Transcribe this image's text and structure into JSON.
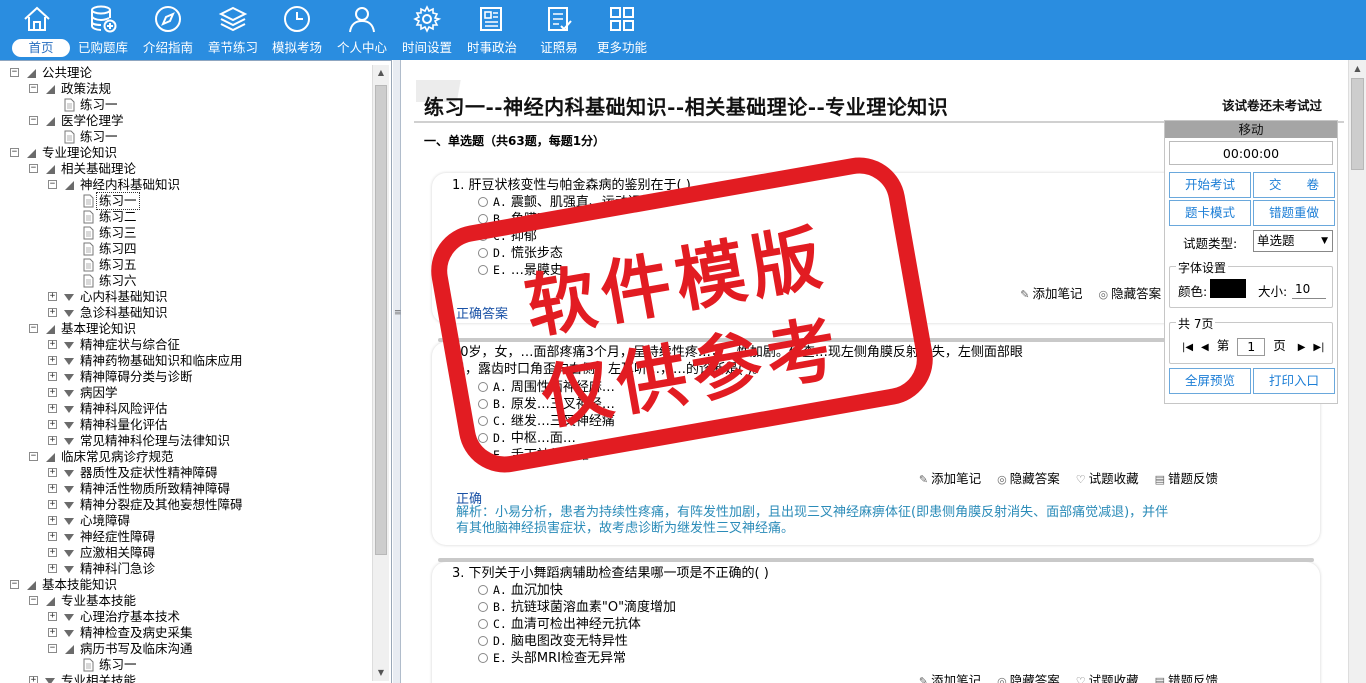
{
  "toolbar": {
    "items": [
      {
        "label": "首页",
        "icon": "home-icon"
      },
      {
        "label": "已购题库",
        "icon": "database-add-icon"
      },
      {
        "label": "介绍指南",
        "icon": "compass-icon"
      },
      {
        "label": "章节练习",
        "icon": "layers-icon"
      },
      {
        "label": "模拟考场",
        "icon": "clock-icon"
      },
      {
        "label": "个人中心",
        "icon": "user-icon"
      },
      {
        "label": "时间设置",
        "icon": "gear-icon"
      },
      {
        "label": "时事政治",
        "icon": "newspaper-icon"
      },
      {
        "label": "证照易",
        "icon": "checklist-icon"
      },
      {
        "label": "更多功能",
        "icon": "grid-icon"
      }
    ],
    "active_index": 0
  },
  "tree": [
    {
      "label": "公共理论",
      "level": 0,
      "type": "folder",
      "expanded": true
    },
    {
      "label": "政策法规",
      "level": 1,
      "type": "folder",
      "expanded": true
    },
    {
      "label": "练习一",
      "level": 2,
      "type": "doc"
    },
    {
      "label": "医学伦理学",
      "level": 1,
      "type": "folder",
      "expanded": true
    },
    {
      "label": "练习一",
      "level": 2,
      "type": "doc"
    },
    {
      "label": "专业理论知识",
      "level": 0,
      "type": "folder",
      "expanded": true
    },
    {
      "label": "相关基础理论",
      "level": 1,
      "type": "folder",
      "expanded": true
    },
    {
      "label": "神经内科基础知识",
      "level": 2,
      "type": "folder",
      "expanded": true
    },
    {
      "label": "练习一",
      "level": 3,
      "type": "doc",
      "selected": true
    },
    {
      "label": "练习二",
      "level": 3,
      "type": "doc"
    },
    {
      "label": "练习三",
      "level": 3,
      "type": "doc"
    },
    {
      "label": "练习四",
      "level": 3,
      "type": "doc"
    },
    {
      "label": "练习五",
      "level": 3,
      "type": "doc"
    },
    {
      "label": "练习六",
      "level": 3,
      "type": "doc"
    },
    {
      "label": "心内科基础知识",
      "level": 2,
      "type": "folder",
      "expanded": false
    },
    {
      "label": "急诊科基础知识",
      "level": 2,
      "type": "folder",
      "expanded": false
    },
    {
      "label": "基本理论知识",
      "level": 1,
      "type": "folder",
      "expanded": true
    },
    {
      "label": "精神症状与综合征",
      "level": 2,
      "type": "folder",
      "expanded": false
    },
    {
      "label": "精神药物基础知识和临床应用",
      "level": 2,
      "type": "folder",
      "expanded": false
    },
    {
      "label": "精神障碍分类与诊断",
      "level": 2,
      "type": "folder",
      "expanded": false
    },
    {
      "label": "病因学",
      "level": 2,
      "type": "folder",
      "expanded": false
    },
    {
      "label": "精神科风险评估",
      "level": 2,
      "type": "folder",
      "expanded": false
    },
    {
      "label": "精神科量化评估",
      "level": 2,
      "type": "folder",
      "expanded": false
    },
    {
      "label": "常见精神科伦理与法律知识",
      "level": 2,
      "type": "folder",
      "expanded": false
    },
    {
      "label": "临床常见病诊疗规范",
      "level": 1,
      "type": "folder",
      "expanded": true
    },
    {
      "label": "器质性及症状性精神障碍",
      "level": 2,
      "type": "folder",
      "expanded": false
    },
    {
      "label": "精神活性物质所致精神障碍",
      "level": 2,
      "type": "folder",
      "expanded": false
    },
    {
      "label": "精神分裂症及其他妄想性障碍",
      "level": 2,
      "type": "folder",
      "expanded": false
    },
    {
      "label": "心境障碍",
      "level": 2,
      "type": "folder",
      "expanded": false
    },
    {
      "label": "神经症性障碍",
      "level": 2,
      "type": "folder",
      "expanded": false
    },
    {
      "label": "应激相关障碍",
      "level": 2,
      "type": "folder",
      "expanded": false
    },
    {
      "label": "精神科门急诊",
      "level": 2,
      "type": "folder",
      "expanded": false
    },
    {
      "label": "基本技能知识",
      "level": 0,
      "type": "folder",
      "expanded": true
    },
    {
      "label": "专业基本技能",
      "level": 1,
      "type": "folder",
      "expanded": true
    },
    {
      "label": "心理治疗基本技术",
      "level": 2,
      "type": "folder",
      "expanded": false
    },
    {
      "label": "精神检查及病史采集",
      "level": 2,
      "type": "folder",
      "expanded": false
    },
    {
      "label": "病历书写及临床沟通",
      "level": 2,
      "type": "folder",
      "expanded": true
    },
    {
      "label": "练习一",
      "level": 3,
      "type": "doc"
    },
    {
      "label": "专业相关技能",
      "level": 1,
      "type": "folder",
      "expanded": false
    }
  ],
  "main": {
    "title": "练习一--神经内科基础知识--相关基础理论--专业理论知识",
    "status": "该试卷还未考试过",
    "section": "一、单选题（共63题，每题1分）",
    "actions": {
      "note": "添加笔记",
      "hide": "隐藏答案",
      "fav": "试题收藏",
      "report": "错题反馈"
    },
    "questions": [
      {
        "stem": "1. 肝豆状核变性与帕金森病的鉴别在于( )",
        "options": [
          {
            "key": "A.",
            "text": "震颤、肌强直、运动迟缓"
          },
          {
            "key": "B.",
            "text": "角膜K-F环"
          },
          {
            "key": "C.",
            "text": "抑郁"
          },
          {
            "key": "D.",
            "text": "慌张步态"
          },
          {
            "key": "E.",
            "text": "…景膜史"
          }
        ],
        "answer": "正确答案",
        "analysis": ""
      },
      {
        "stem_line1": "30岁，女，…面部疼痛3个月，呈持续性疼…，…性加剧。体查…现左侧角膜反射消失，左侧面部眼",
        "stem_line2": "退，露齿时口角歪向右侧，左耳听…，…的诊断是( )。",
        "options": [
          {
            "key": "A.",
            "text": "周围性面神经麻…"
          },
          {
            "key": "B.",
            "text": "原发…三叉神经…"
          },
          {
            "key": "C.",
            "text": "继发…三叉神经痛"
          },
          {
            "key": "D.",
            "text": "中枢…面…"
          },
          {
            "key": "E.",
            "text": "舌下神经…瘫"
          }
        ],
        "answer": "正确",
        "analysis_line1": "解析：小易分析，患者为持续性疼痛，有阵发性加剧，且出现三叉神经麻痹体征(即患侧角膜反射消失、面部痛觉减退)，并伴",
        "analysis_line2": "有其他脑神经损害症状，故考虑诊断为继发性三叉神经痛。"
      },
      {
        "stem": "3. 下列关于小舞蹈病辅助检查结果哪一项是不正确的( )",
        "options": [
          {
            "key": "A.",
            "text": "血沉加快"
          },
          {
            "key": "B.",
            "text": "抗链球菌溶血素\"O\"滴度增加"
          },
          {
            "key": "C.",
            "text": "血清可检出神经元抗体"
          },
          {
            "key": "D.",
            "text": "脑电图改变无特异性"
          },
          {
            "key": "E.",
            "text": "头部MRI检查无异常"
          }
        ]
      }
    ]
  },
  "panel": {
    "title": "移动",
    "timer": "00:00:00",
    "start": "开始考试",
    "submit": "交　　卷",
    "card_mode": "题卡模式",
    "redo_wrong": "错题重做",
    "qtype_label": "试题类型:",
    "qtype_value": "单选题",
    "font_legend": "字体设置",
    "color_label": "颜色:",
    "size_label": "大小:",
    "size_value": "10",
    "pages_legend": "共 7页",
    "page_prefix": "第",
    "page_value": "1",
    "page_suffix": "页",
    "fullscreen": "全屏预览",
    "print": "打印入口",
    "font_color": "#000000"
  },
  "watermark": {
    "line1": "软件模版",
    "line2": "仅供参考",
    "color": "#e21c22"
  }
}
